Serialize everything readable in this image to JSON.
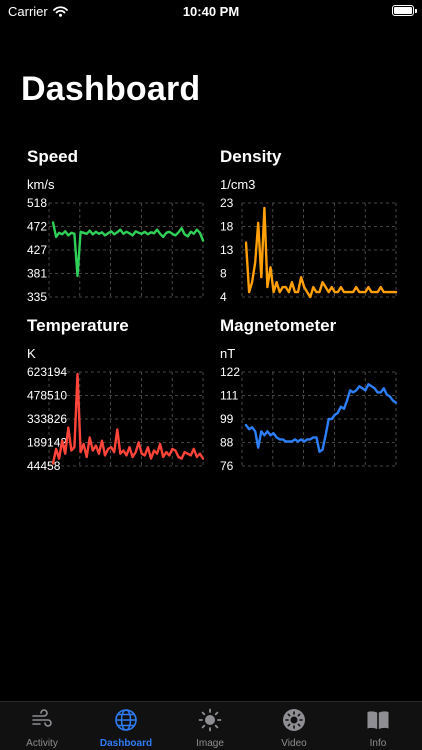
{
  "status_bar": {
    "carrier": "Carrier",
    "time": "10:40 PM"
  },
  "page": {
    "title": "Dashboard"
  },
  "charts": [
    {
      "id": "speed",
      "title": "Speed",
      "unit": "km/s",
      "color": "#30d158",
      "ticks": [
        "518",
        "472",
        "427",
        "381",
        "335"
      ],
      "ylim": [
        335,
        518
      ],
      "values": [
        480,
        452,
        460,
        457,
        463,
        455,
        460,
        458,
        376,
        462,
        460,
        458,
        464,
        457,
        462,
        458,
        461,
        455,
        459,
        463,
        457,
        461,
        466,
        458,
        462,
        459,
        455,
        463,
        460,
        458,
        462,
        457,
        461,
        459,
        466,
        458,
        452,
        460,
        462,
        458,
        455,
        461,
        469,
        457,
        453,
        462,
        458,
        466,
        460,
        445
      ]
    },
    {
      "id": "density",
      "title": "Density",
      "unit": "1/cm3",
      "color": "#ff9f0a",
      "ticks": [
        "23",
        "18",
        "13",
        "8",
        "4"
      ],
      "ylim": [
        4,
        23
      ],
      "values": [
        15,
        5,
        7,
        11,
        19,
        8,
        22,
        6,
        10,
        5,
        7,
        5,
        6,
        6,
        5,
        7,
        5,
        5,
        8,
        6,
        5,
        4,
        6,
        5,
        5,
        7,
        6,
        5,
        6,
        5,
        5,
        6,
        5,
        5,
        5,
        5,
        6,
        5,
        5,
        5,
        6,
        5,
        5,
        5,
        6,
        5,
        5,
        5,
        5,
        5
      ]
    },
    {
      "id": "temperature",
      "title": "Temperature",
      "unit": "K",
      "color": "#ff453a",
      "ticks": [
        "623194",
        "478510",
        "333826",
        "189142",
        "44458"
      ],
      "ylim": [
        44458,
        623194
      ],
      "values": [
        60000,
        150000,
        90000,
        200000,
        120000,
        280000,
        140000,
        160000,
        610000,
        130000,
        180000,
        100000,
        220000,
        140000,
        170000,
        120000,
        200000,
        110000,
        150000,
        160000,
        130000,
        270000,
        120000,
        140000,
        110000,
        160000,
        100000,
        130000,
        190000,
        120000,
        110000,
        160000,
        90000,
        140000,
        120000,
        180000,
        100000,
        130000,
        110000,
        150000,
        140000,
        100000,
        90000,
        130000,
        120000,
        110000,
        150000,
        100000,
        120000,
        90000
      ]
    },
    {
      "id": "magnetometer",
      "title": "Magnetometer",
      "unit": "nT",
      "color": "#2d7ff9",
      "ticks": [
        "122",
        "111",
        "99",
        "88",
        "76"
      ],
      "ylim": [
        76,
        122
      ],
      "values": [
        96,
        94,
        95,
        93,
        85,
        93,
        91,
        93,
        91,
        92,
        90,
        89,
        89,
        88,
        88,
        88,
        89,
        88,
        89,
        88,
        89,
        89,
        90,
        90,
        83,
        84,
        91,
        99,
        99,
        101,
        102,
        105,
        104,
        108,
        113,
        112,
        113,
        115,
        114,
        113,
        116,
        115,
        114,
        112,
        112,
        114,
        111,
        110,
        108,
        107
      ]
    }
  ],
  "tabs": [
    {
      "label": "Activity",
      "icon": "wind-icon",
      "active": false
    },
    {
      "label": "Dashboard",
      "icon": "globe-icon",
      "active": true
    },
    {
      "label": "Image",
      "icon": "sun-icon",
      "active": false
    },
    {
      "label": "Video",
      "icon": "sun-circle-icon",
      "active": false
    },
    {
      "label": "Info",
      "icon": "book-icon",
      "active": false
    }
  ]
}
